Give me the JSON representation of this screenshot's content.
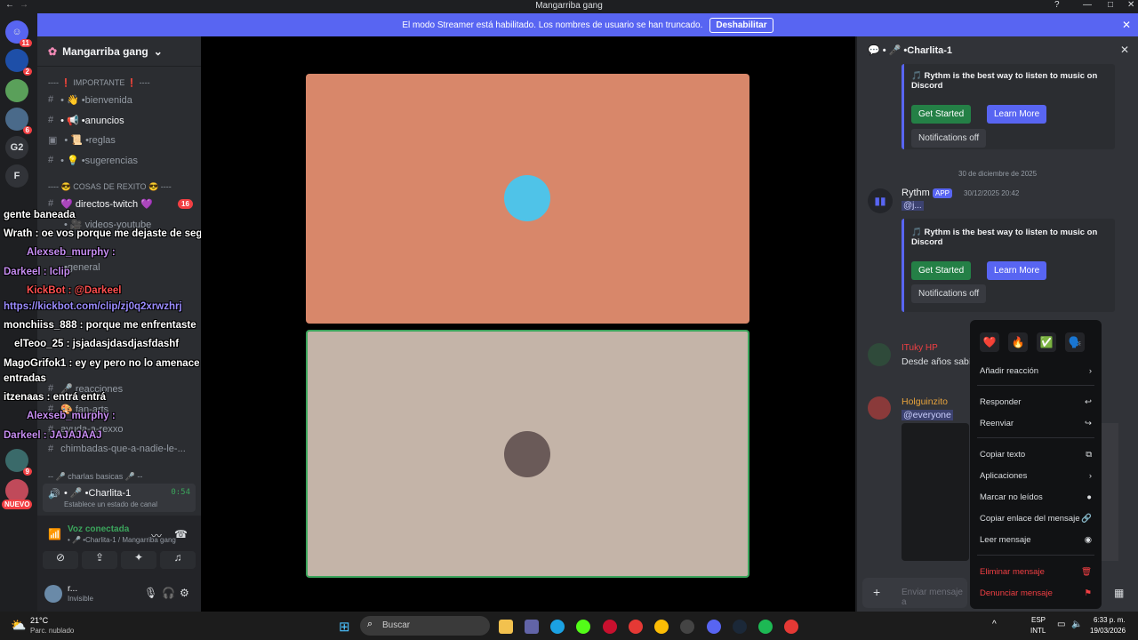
{
  "window": {
    "title": "Mangarriba gang"
  },
  "banner": {
    "text": "El modo Streamer está habilitado. Los nombres de usuario se han truncado.",
    "button": "Deshabilitar"
  },
  "servers": [
    {
      "badge": "11"
    },
    {
      "badge": "2"
    },
    {
      "badge": ""
    },
    {
      "badge": "6"
    },
    {
      "label": "G2"
    },
    {
      "label": "F"
    },
    {
      "badge": "21"
    },
    {
      "badge": "221"
    },
    {
      "badge": "21"
    },
    {
      "badge": "536"
    },
    {
      "badge": "3"
    },
    {
      "badge": "9"
    },
    {
      "badge": "NUEVO"
    }
  ],
  "guild": {
    "name": "Mangarriba gang"
  },
  "categories": {
    "importante": "---- ❗ IMPORTANTE ❗ ----",
    "rexito": "---- 😎 COSAS DE REXITO 😎 ----",
    "charlas": "-- 🎤 charlas basicas 🎤 --"
  },
  "channels": {
    "bienvenida": "• 👋 •bienvenida",
    "anuncios": "• 📢 •anuncios",
    "reglas": "• 📜 •reglas",
    "sugerencias": "• 💡 •sugerencias",
    "twitch": "💜 directos-twitch 💜",
    "twitch_badge": "16",
    "youtube": "• 🎥 videos-youtube",
    "general": "•general",
    "reacciones": "🎤 reacciones",
    "fanarts": "🎨 fan-arts",
    "ayuda": "ayuda-a-rexxo",
    "chimbadas": "chimbadas-que-a-nadie-le-...",
    "charlita": "• 🎤 •Charlita-1",
    "charlita_time": "0:54",
    "charlita_status": "Establece un estado de canal"
  },
  "voice": {
    "status": "Voz conectada",
    "location": "• 🎤 •Charlita-1 / Mangarriba gang"
  },
  "user": {
    "name": "r...",
    "status": "Invisible"
  },
  "overlay": [
    {
      "text": "gente baneada"
    },
    {
      "text": "Wrath : oe vos porque me dejaste de seguir HP"
    },
    {
      "text": "Alexseb_murphy :"
    },
    {
      "text": "Darkeel : Iclip"
    },
    {
      "text": "KickBot : @Darkeel"
    },
    {
      "text": "https://kickbot.com/clip/zj0q2xrwzhrj"
    },
    {
      "text": "monchiiss_888 : porque me enfrentaste"
    },
    {
      "text": "elTeoo_25 : jsjadasjdasdjasfdashf"
    },
    {
      "text": "MagoGrifok1 : ey ey pero no lo amenace con esas"
    },
    {
      "text": "entradas"
    },
    {
      "text": "itzenaas : entrá entrá"
    },
    {
      "text": "Alexseb_murphy :"
    },
    {
      "text": "Darkeel : JAJAJAAJ"
    }
  ],
  "right": {
    "header": "• 🎤 •Charlita-1",
    "embed_text": "🎵 Rythm is the best way to listen to music on Discord",
    "get_started": "Get Started",
    "learn_more": "Learn More",
    "notifications": "Notifications off",
    "date_sep": "30 de diciembre de 2025",
    "rythm_name": "Rythm",
    "app_tag": "APP",
    "rythm_time": "30/12/2025 20:42",
    "rythm_mention": "@j...",
    "msg1_author": "ITuky HP",
    "msg1_text": "Desde años sabía",
    "msg2_author": "Holguinzito",
    "msg2_text": "@everyone",
    "input_placeholder": "Enviar mensaje a"
  },
  "menu": {
    "add_reaction": "Añadir reacción",
    "reply": "Responder",
    "forward": "Reenviar",
    "copy_text": "Copiar texto",
    "apps": "Aplicaciones",
    "mark_unread": "Marcar no leídos",
    "copy_link": "Copiar enlace del mensaje",
    "read": "Leer mensaje",
    "delete": "Eliminar mensaje",
    "report": "Denunciar mensaje",
    "reactions": [
      "❤️",
      "🔥",
      "✅",
      "🗣️"
    ]
  },
  "taskbar": {
    "weather": "21°C",
    "weather_sub": "Parc. nublado",
    "search": "Buscar",
    "lang": "ESP",
    "lang2": "INTL",
    "time": "6:33 p. m.",
    "date": "19/03/2026"
  },
  "colors": {
    "blurple": "#5865f2",
    "green": "#248046",
    "red": "#f23f43"
  }
}
